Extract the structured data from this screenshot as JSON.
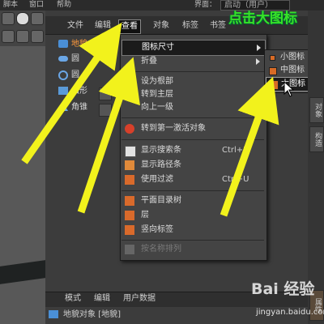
{
  "topbar": {
    "menu_script": "脚本",
    "menu_window": "窗口",
    "menu_help": "帮助",
    "layout_label": "界面：",
    "layout_value": "启动（用户）"
  },
  "object_manager": {
    "menus": [
      "文件",
      "编辑",
      "查看",
      "对象",
      "标签",
      "书签"
    ],
    "objects": [
      {
        "label": "地貌",
        "icon": "landscape-icon"
      },
      {
        "label": "圆",
        "icon": "disc-icon"
      },
      {
        "label": "圆",
        "icon": "circle-icon"
      },
      {
        "label": "山形",
        "icon": "mountain-icon"
      },
      {
        "label": "角锥",
        "icon": "pyramid-icon"
      }
    ]
  },
  "view_menu": {
    "items": [
      {
        "label": "图标尺寸",
        "has_submenu": true,
        "icon": ""
      },
      {
        "label": "折叠",
        "has_submenu": true,
        "icon": ""
      },
      {
        "label": "设为根部",
        "icon": ""
      },
      {
        "label": "转到主层",
        "icon": ""
      },
      {
        "label": "向上一级",
        "icon": ""
      },
      {
        "label": "转到第一激活对象",
        "icon": "target-icon"
      },
      {
        "label": "显示搜索条",
        "shortcut": "Ctrl+F",
        "icon": "search-bar-icon"
      },
      {
        "label": "显示路径条",
        "icon": "path-bar-icon"
      },
      {
        "label": "使用过滤",
        "shortcut": "Ctrl+U",
        "icon": "filter-icon"
      },
      {
        "label": "平面目录树",
        "icon": "tree-icon"
      },
      {
        "label": "层",
        "icon": "layer-icon"
      },
      {
        "label": "竖向标签",
        "icon": "vertical-tag-icon"
      },
      {
        "label": "按名称排列",
        "disabled": true,
        "icon": "sort-icon"
      }
    ]
  },
  "icon_size_submenu": {
    "items": [
      {
        "label": "小图标"
      },
      {
        "label": "中图标"
      },
      {
        "label": "大图标",
        "selected": true
      }
    ]
  },
  "annotation": {
    "text": "点击大图标",
    "color": "#38e028"
  },
  "arrow_color": "#f2f21c",
  "right_tabs": [
    "对象",
    "构造",
    "属性"
  ],
  "attributes_panel": {
    "menus": [
      "模式",
      "编辑",
      "用户数据"
    ],
    "object_line": "地貌对象 [地貌]"
  },
  "watermark": {
    "brand": "Bai 经验",
    "url": "jingyan.baidu.com"
  }
}
